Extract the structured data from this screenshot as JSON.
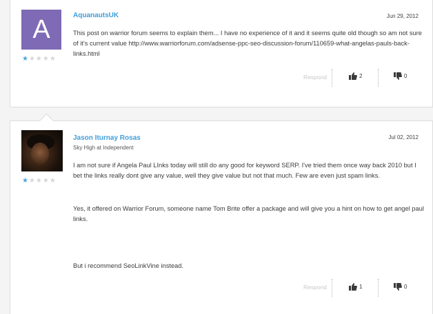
{
  "posts": [
    {
      "avatar_letter": "A",
      "avatar_color": "#7e6ab5",
      "username": "AquanautsUK",
      "date": "Jun 29, 2012",
      "rating": 1,
      "rating_max": 5,
      "stars_on": "★",
      "stars_off": "★★★★",
      "paragraphs": [
        "This post on warrior forum seems to explain them... I have no experience of it and it seems quite old though so am not sure of it's current value http://www.warriorforum.com/adsense-ppc-seo-discussion-forum/110659-what-angelas-pauls-back-links.html"
      ],
      "respond_label": "Respond",
      "upvotes": "2",
      "downvotes": "0"
    },
    {
      "username": "Jason Iturnay Rosas",
      "subtitle": "Sky High at Independent",
      "date": "Jul 02, 2012",
      "rating": 1,
      "rating_max": 5,
      "stars_on": "★",
      "stars_off": "★★★★",
      "paragraphs": [
        "I am not sure if Angela Paul LInks today will still do any good for keyword SERP. I've tried them once way back 2010 but I bet the links really dont give any value, well they give value but not that much. Few are even just spam links.",
        "Yes, it offered on Warrior Forum, someone name Tom Brite offer a package and will give you a hint on how to get angel paul links.",
        "But i recommend SeoLinkVine instead."
      ],
      "respond_label": "Respond",
      "upvotes": "1",
      "downvotes": "0"
    }
  ],
  "colors": {
    "username": "#3f9ed8",
    "star_active": "#4aa3df",
    "star_inactive": "#d6d6d6",
    "respond": "#c8c8c8"
  },
  "icons": [
    "thumbs-up-icon",
    "thumbs-down-icon",
    "star-icon"
  ]
}
